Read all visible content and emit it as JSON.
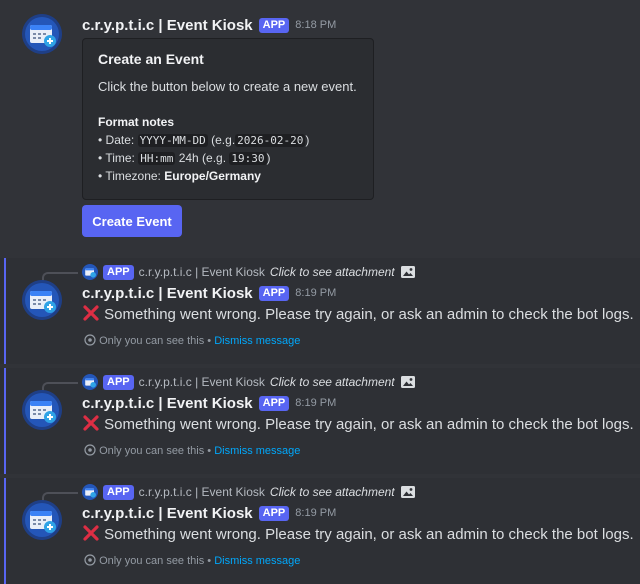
{
  "bot": {
    "name": "c.r.y.p.t.i.c | Event Kiosk",
    "badge": "APP"
  },
  "first_message": {
    "timestamp": "8:18 PM",
    "embed": {
      "title": "Create an Event",
      "description": "Click the button below to create a new event.",
      "format_heading": "Format notes",
      "date_prefix": "• Date:",
      "date_format": "YYYY-MM-DD",
      "date_example_open": "(e.g.",
      "date_example": "2026-02-20",
      "date_example_close": ")",
      "time_prefix": "• Time:",
      "time_format": "HH:mm",
      "time_suffix": "24h (e.g.",
      "time_example": "19:30",
      "time_example_close": ")",
      "tz_prefix": "• Timezone:",
      "tz_value": "Europe/Germany"
    },
    "button_label": "Create Event"
  },
  "replies": [
    {
      "reply_name": "c.r.y.p.t.i.c | Event Kiosk",
      "reply_attachment": "Click to see attachment",
      "timestamp": "8:19 PM",
      "text": "Something went wrong. Please try again, or ask an admin to check the bot logs.",
      "ephemeral": "Only you can see this •",
      "dismiss": "Dismiss message"
    },
    {
      "reply_name": "c.r.y.p.t.i.c | Event Kiosk",
      "reply_attachment": "Click to see attachment",
      "timestamp": "8:19 PM",
      "text": "Something went wrong. Please try again, or ask an admin to check the bot logs.",
      "ephemeral": "Only you can see this •",
      "dismiss": "Dismiss message"
    },
    {
      "reply_name": "c.r.y.p.t.i.c | Event Kiosk",
      "reply_attachment": "Click to see attachment",
      "timestamp": "8:19 PM",
      "text": "Something went wrong. Please try again, or ask an admin to check the bot logs.",
      "ephemeral": "Only you can see this •",
      "dismiss": "Dismiss message"
    }
  ],
  "icons": {
    "avatar": "calendar-plus-icon",
    "error": "cross-mark-icon",
    "ephemeral": "eye-icon",
    "attachment": "image-icon"
  },
  "colors": {
    "background": "#313338",
    "ephemeral_background": "#2e3035",
    "accent": "#5865f2",
    "link": "#00a8fc",
    "error": "#dd2e44"
  }
}
